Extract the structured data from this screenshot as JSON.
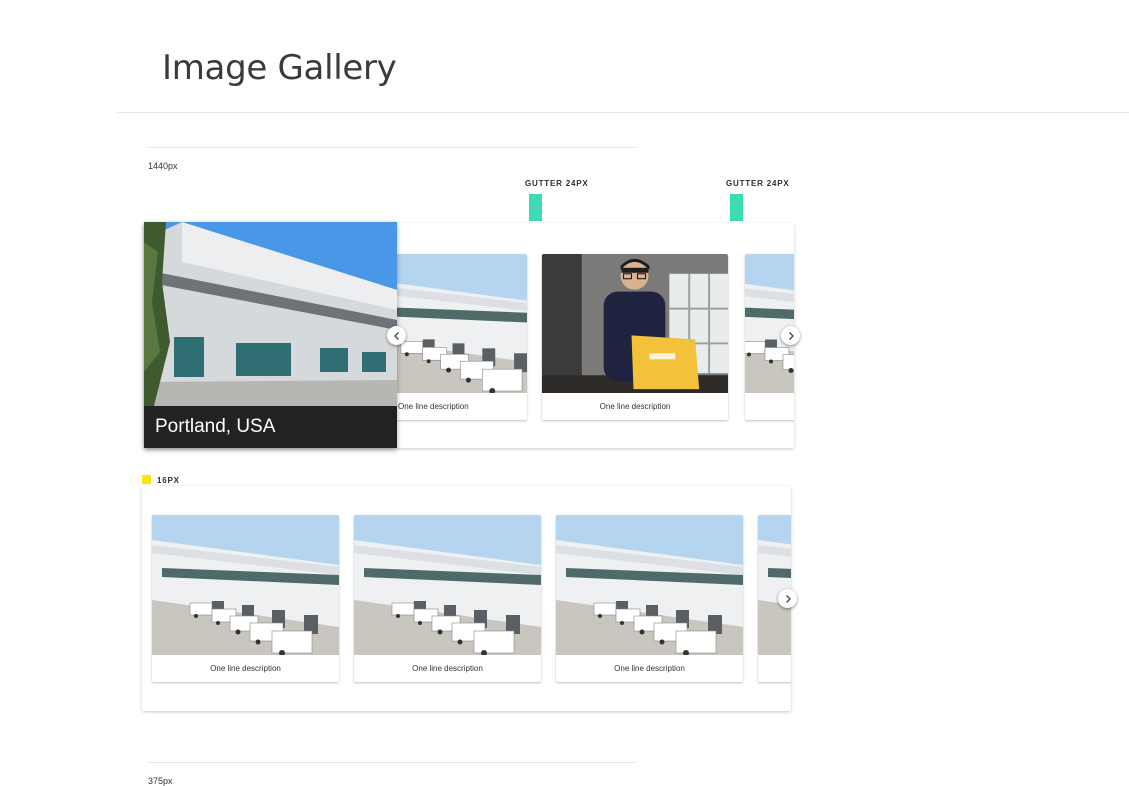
{
  "page": {
    "title": "Image Gallery"
  },
  "section_desktop": {
    "breakpoint_label": "1440px",
    "gutter_label_left": "GUTTER 24PX",
    "gutter_label_right": "GUTTER 24PX",
    "hero": {
      "caption": "Portland, USA"
    },
    "cards": [
      {
        "description": "One line description",
        "image": "warehouse-photo"
      },
      {
        "description": "One line description",
        "image": "person-with-package-photo"
      },
      {
        "description": "",
        "image": "warehouse-photo"
      }
    ],
    "prev_icon": "chevron-left-icon",
    "next_icon": "chevron-right-icon"
  },
  "section_spacing": {
    "spacing_label": "16PX",
    "swatch_color": "#ffe600",
    "cards": [
      {
        "description": "One line description",
        "image": "warehouse-photo"
      },
      {
        "description": "One line description",
        "image": "warehouse-photo"
      },
      {
        "description": "One line description",
        "image": "warehouse-photo"
      },
      {
        "description": "",
        "image": "warehouse-photo"
      }
    ],
    "next_icon": "chevron-right-icon"
  },
  "section_mobile": {
    "breakpoint_label": "375px"
  },
  "colors": {
    "gutter": "#3ddbb3",
    "caption_bg": "#222222"
  }
}
